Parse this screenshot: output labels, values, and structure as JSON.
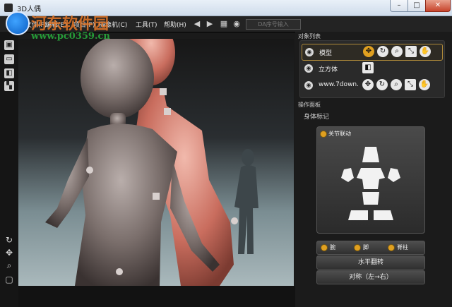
{
  "window": {
    "title": "3D人偶",
    "minimize_glyph": "–",
    "maximize_glyph": "□",
    "close_glyph": "✕"
  },
  "watermark": {
    "text": "河东软件园",
    "url": "www.pc0359.cn"
  },
  "menu": {
    "items": [
      "文件(F)",
      "编辑(E)",
      "项目(P)",
      "摄像机(C)",
      "工具(T)",
      "帮助(H)"
    ],
    "da_input_placeholder": "DA序号输入"
  },
  "toolbar_icons": [
    "arrow-left-icon",
    "arrow-right-icon",
    "clapper-icon",
    "camera-icon"
  ],
  "left_tools": [
    "cube-icon",
    "window-icon",
    "box-icon",
    "multi-icon",
    "rotate-icon",
    "move-icon",
    "zoom-icon",
    "screenshot-icon"
  ],
  "panel": {
    "object_list_label": "对象列表",
    "objects": [
      {
        "name": "模型",
        "selected": true,
        "icons": [
          "move-icon",
          "rotate-icon",
          "zoom-icon",
          "scale-icon",
          "hand-icon"
        ]
      },
      {
        "name": "立方体",
        "selected": false,
        "icons": [
          "box-icon"
        ]
      },
      {
        "name": "www.7down.",
        "selected": false,
        "icons": [
          "move-icon",
          "rotate-icon",
          "zoom-icon",
          "scale-icon",
          "hand-icon"
        ]
      }
    ],
    "ops_label": "操作面板",
    "body_marker_label": "身体标记",
    "joint_link_label": "关节联动",
    "options": [
      "腕",
      "脚",
      "脊柱"
    ],
    "flip_button": "水平翻转",
    "symmetry_button": "对称（左→右）"
  },
  "colors": {
    "accent": "#e0a020",
    "background": "#1b1b1b",
    "figure_front": "#8a7f7c",
    "figure_back": "#d88a7a"
  }
}
